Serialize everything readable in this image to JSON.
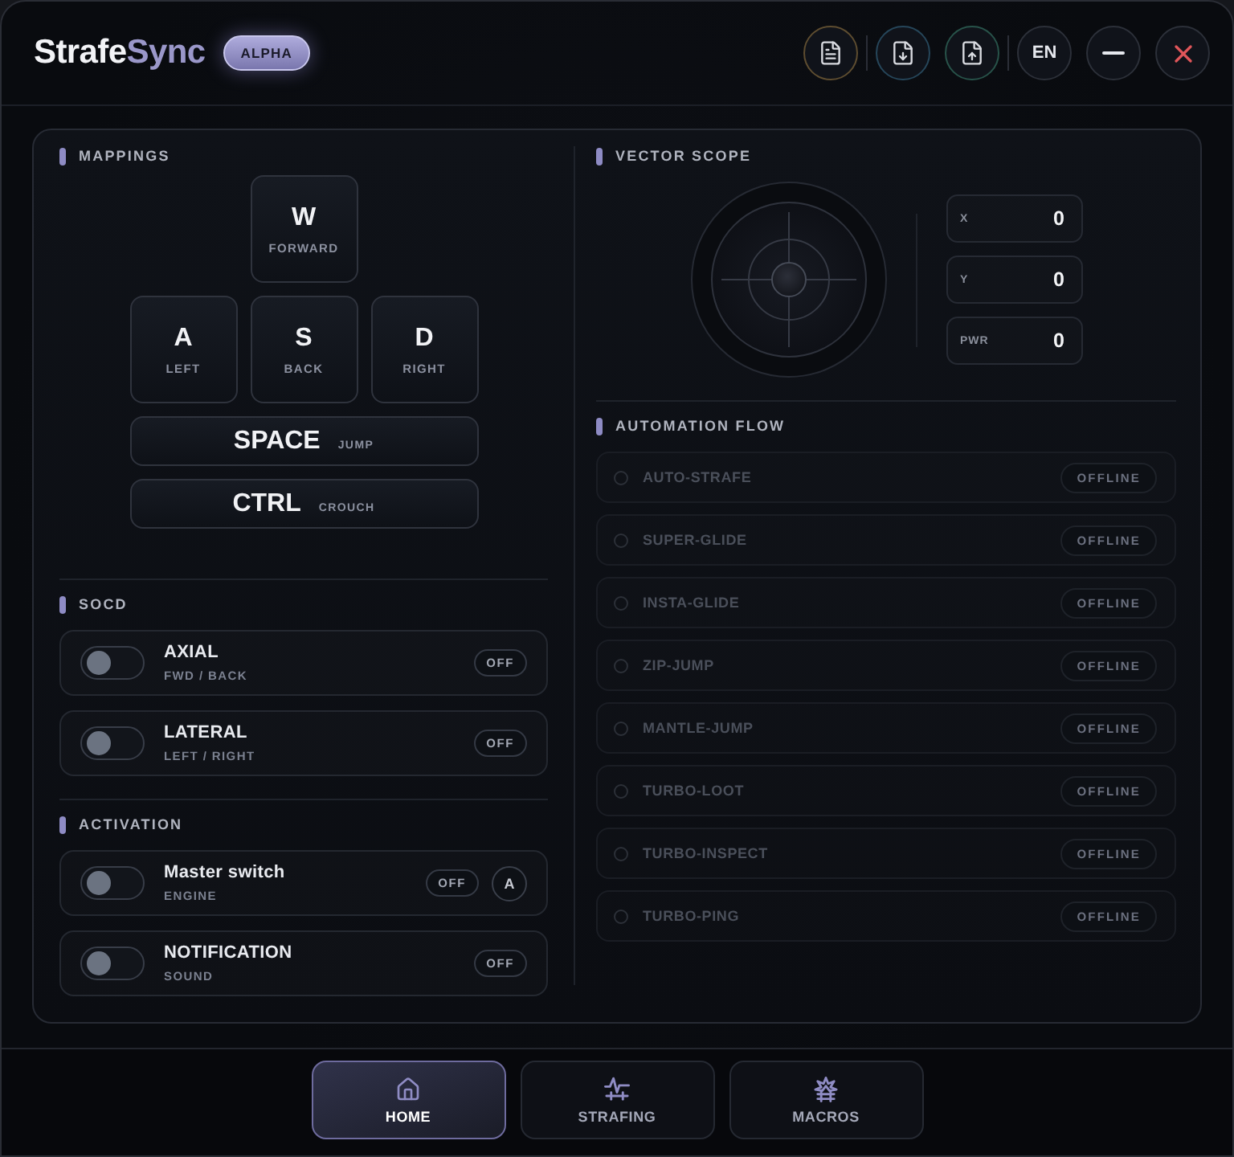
{
  "header": {
    "title_main": "Strafe",
    "title_accent": "Sync",
    "badge": "ALPHA",
    "language": "EN"
  },
  "mappings": {
    "title": "MAPPINGS",
    "key_rows": [
      [
        {
          "kind": "square",
          "key": "W",
          "action": "FORWARD"
        }
      ],
      [
        {
          "kind": "square",
          "key": "A",
          "action": "LEFT"
        },
        {
          "kind": "square",
          "key": "S",
          "action": "BACK"
        },
        {
          "kind": "square",
          "key": "D",
          "action": "RIGHT"
        }
      ],
      [
        {
          "kind": "wide",
          "key": "SPACE",
          "action": "JUMP"
        }
      ],
      [
        {
          "kind": "wide",
          "key": "CTRL",
          "action": "CROUCH"
        }
      ]
    ]
  },
  "socd": {
    "title": "SOCD",
    "rows": [
      {
        "label": "AXIAL",
        "sublabel": "FWD / BACK",
        "on": false,
        "status": "OFF"
      },
      {
        "label": "LATERAL",
        "sublabel": "LEFT / RIGHT",
        "on": false,
        "status": "OFF"
      }
    ]
  },
  "activation": {
    "title": "ACTIVATION",
    "rows": [
      {
        "label": "Master switch",
        "sublabel": "ENGINE",
        "on": false,
        "status": "OFF",
        "hotkey": "A"
      },
      {
        "label": "NOTIFICATION",
        "sublabel": "SOUND",
        "on": false,
        "status": "OFF"
      }
    ]
  },
  "vector_scope": {
    "title": "VECTOR SCOPE",
    "readouts": [
      {
        "label": "X",
        "value": "0"
      },
      {
        "label": "Y",
        "value": "0"
      },
      {
        "label": "PWR",
        "value": "0"
      }
    ]
  },
  "automation_flow": {
    "title": "AUTOMATION FLOW",
    "items": [
      {
        "label": "AUTO-STRAFE",
        "status": "OFFLINE",
        "active": false
      },
      {
        "label": "SUPER-GLIDE",
        "status": "OFFLINE",
        "active": false
      },
      {
        "label": "INSTA-GLIDE",
        "status": "OFFLINE",
        "active": false
      },
      {
        "label": "ZIP-JUMP",
        "status": "OFFLINE",
        "active": false
      },
      {
        "label": "MANTLE-JUMP",
        "status": "OFFLINE",
        "active": false
      },
      {
        "label": "TURBO-LOOT",
        "status": "OFFLINE",
        "active": false
      },
      {
        "label": "TURBO-INSPECT",
        "status": "OFFLINE",
        "active": false
      },
      {
        "label": "TURBO-PING",
        "status": "OFFLINE",
        "active": false
      }
    ]
  },
  "nav_tabs": [
    {
      "label": "HOME",
      "kind": "home",
      "selected": true
    },
    {
      "label": "STRAFING",
      "kind": "strafing",
      "selected": false
    },
    {
      "label": "MACROS",
      "kind": "macros",
      "selected": false
    }
  ]
}
